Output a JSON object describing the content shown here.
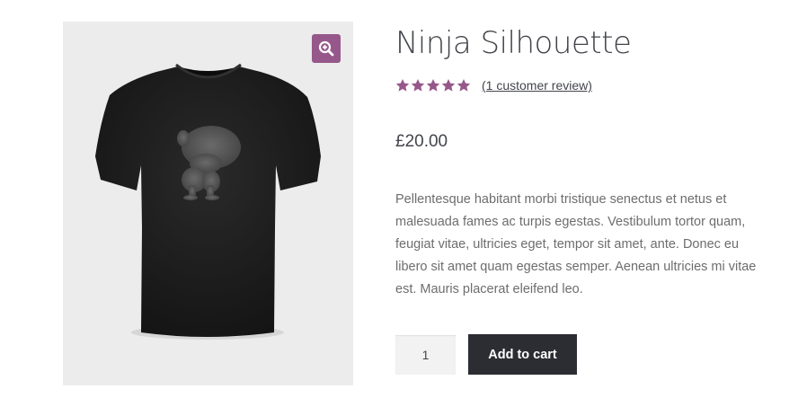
{
  "product": {
    "title": "Ninja Silhouette",
    "rating": {
      "stars": 5,
      "max": 5,
      "review_link": "(1 customer review)"
    },
    "price": "£20.00",
    "description": "Pellentesque habitant morbi tristique senectus et netus et malesuada fames ac turpis egestas. Vestibulum tortor quam, feugiat vitae, ultricies eget, tempor sit amet, ante. Donec eu libero sit amet quam egestas semper. Aenean ultricies mi vitae est. Mauris placerat eleifend leo.",
    "quantity": "1",
    "add_to_cart_label": "Add to cart"
  },
  "gallery": {
    "zoom_icon": "zoom-in-icon",
    "image": "black t-shirt with grey ninja silhouette"
  },
  "colors": {
    "accent": "#96588a",
    "button_dark": "#2c2d33",
    "gallery_bg": "#ececec",
    "text": "#43454b"
  }
}
